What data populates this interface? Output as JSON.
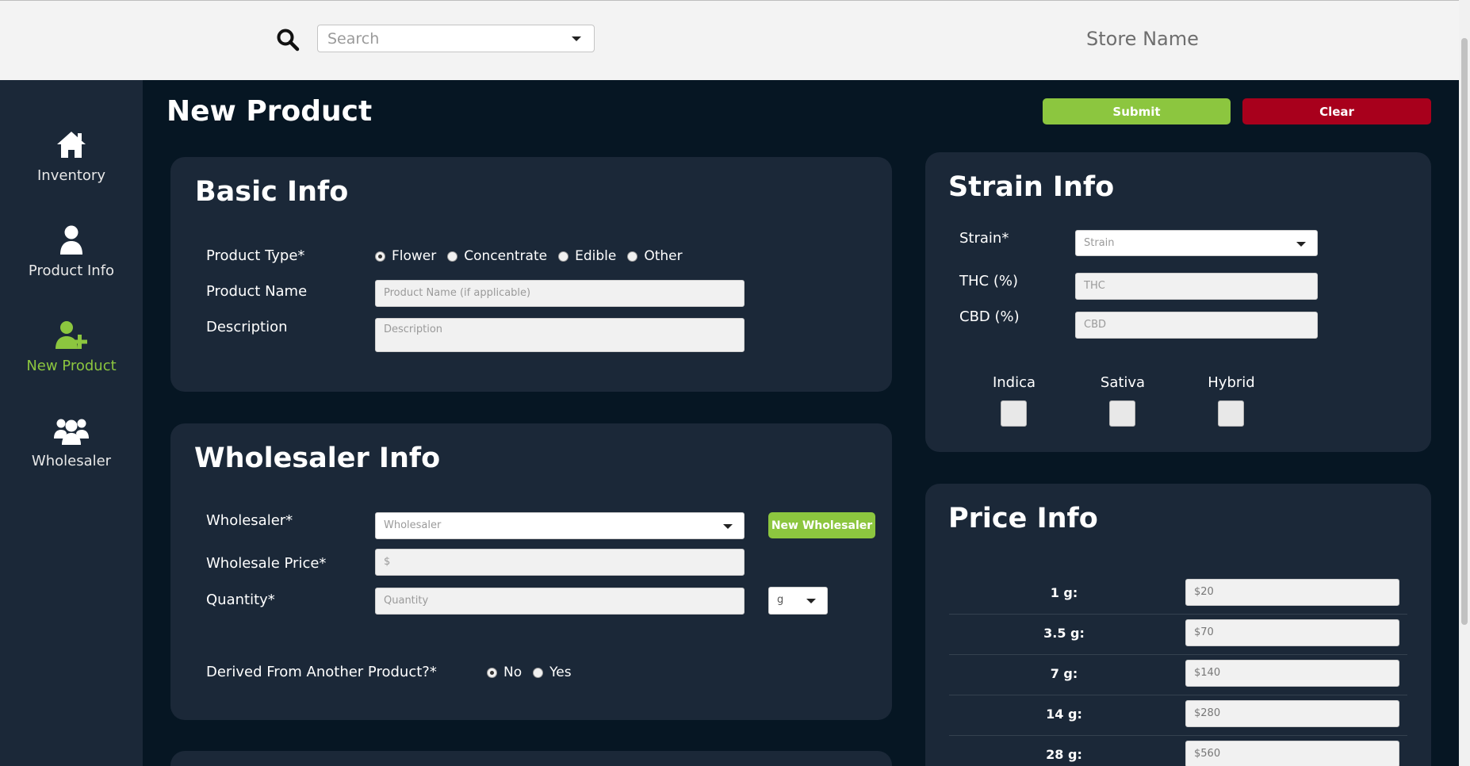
{
  "topbar": {
    "search_placeholder": "Search",
    "store_name": "Store Name"
  },
  "sidebar": {
    "items": [
      {
        "label": "Inventory",
        "icon": "home-icon"
      },
      {
        "label": "Product Info",
        "icon": "user-icon"
      },
      {
        "label": "New Product",
        "icon": "user-plus-icon",
        "active": true
      },
      {
        "label": "Wholesaler",
        "icon": "users-icon"
      }
    ]
  },
  "page": {
    "title": "New Product",
    "submit_label": "Submit",
    "clear_label": "Clear"
  },
  "basic_info": {
    "title": "Basic Info",
    "product_type_label": "Product Type*",
    "product_types": [
      "Flower",
      "Concentrate",
      "Edible",
      "Other"
    ],
    "product_type_selected": "Flower",
    "product_name_label": "Product Name",
    "product_name_placeholder": "Product Name (if applicable)",
    "description_label": "Description",
    "description_placeholder": "Description"
  },
  "wholesaler_info": {
    "title": "Wholesaler Info",
    "wholesaler_label": "Wholesaler*",
    "wholesaler_placeholder": "Wholesaler",
    "new_wholesaler_label": "New Wholesaler",
    "price_label": "Wholesale Price*",
    "price_placeholder": "$",
    "quantity_label": "Quantity*",
    "quantity_placeholder": "Quantity",
    "unit_value": "g",
    "derived_label": "Derived From Another Product?*",
    "derived_options": [
      "No",
      "Yes"
    ],
    "derived_selected": "No"
  },
  "strain_info": {
    "title": "Strain Info",
    "strain_label": "Strain*",
    "strain_placeholder": "Strain",
    "thc_label": "THC (%)",
    "thc_placeholder": "THC",
    "cbd_label": "CBD (%)",
    "cbd_placeholder": "CBD",
    "types": [
      "Indica",
      "Sativa",
      "Hybrid"
    ]
  },
  "price_info": {
    "title": "Price Info",
    "rows": [
      {
        "label": "1 g:",
        "value": "$20"
      },
      {
        "label": "3.5 g:",
        "value": "$70"
      },
      {
        "label": "7 g:",
        "value": "$140"
      },
      {
        "label": "14 g:",
        "value": "$280"
      },
      {
        "label": "28 g:",
        "value": "$560"
      }
    ]
  },
  "colors": {
    "accent_green": "#8cc63f",
    "clear_red": "#a8001c",
    "page_bg": "#061623",
    "card_bg": "#1b2838"
  }
}
